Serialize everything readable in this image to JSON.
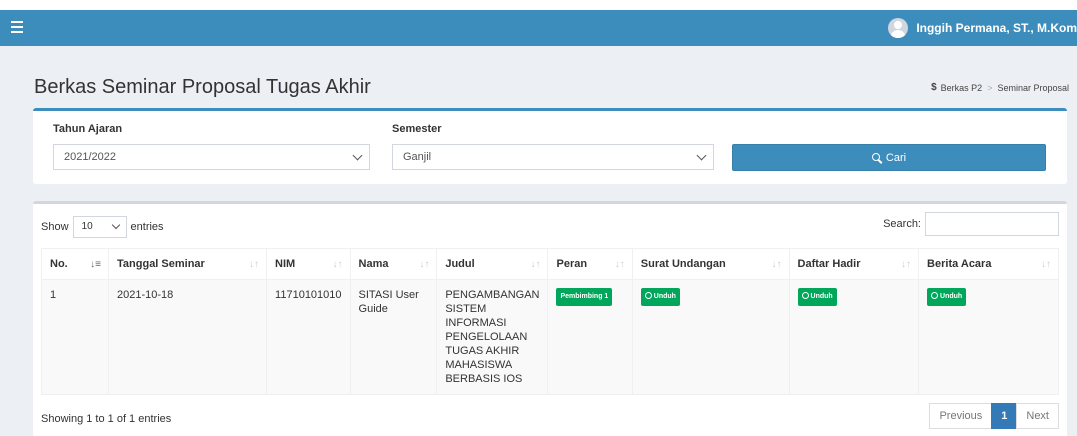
{
  "header": {
    "user_name": "Inggih Permana, ST., M.Kom"
  },
  "page": {
    "title": "Berkas Seminar Proposal Tugas Akhir"
  },
  "breadcrumb": {
    "root": "Berkas P2",
    "current": "Seminar Proposal"
  },
  "filters": {
    "year_label": "Tahun Ajaran",
    "year_value": "2021/2022",
    "semester_label": "Semester",
    "semester_value": "Ganjil",
    "search_button": "Cari"
  },
  "table": {
    "show_label": "Show",
    "entries_value": "10",
    "entries_label": "entries",
    "search_label": "Search:",
    "columns": [
      "No.",
      "Tanggal Seminar",
      "NIM",
      "Nama",
      "Judul",
      "Peran",
      "Surat Undangan",
      "Daftar Hadir",
      "Berita Acara"
    ],
    "rows": [
      {
        "no": "1",
        "tanggal": "2021-10-18",
        "nim": "11710101010",
        "nama": "SITASI User Guide",
        "judul": "PENGAMBANGAN SISTEM INFORMASI PENGELOLAAN TUGAS AKHIR MAHASISWA BERBASIS IOS",
        "peran": "Pembimbing 1",
        "undangan": "Unduh",
        "hadir": "Unduh",
        "berita": "Unduh"
      }
    ],
    "info": "Showing 1 to 1 of 1 entries",
    "pagination": {
      "prev": "Previous",
      "page": "1",
      "next": "Next"
    }
  },
  "colors": {
    "primary": "#3c8dbc",
    "success": "#00a65a",
    "background": "#ecf0f5"
  }
}
